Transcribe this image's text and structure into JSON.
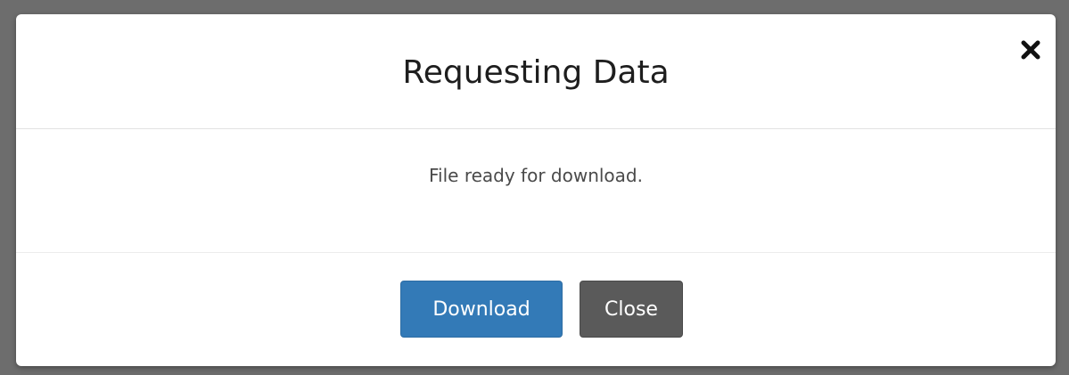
{
  "dialog": {
    "title": "Requesting Data",
    "close_icon": "close-x-icon",
    "message": "File ready for download.",
    "buttons": {
      "download_label": "Download",
      "close_label": "Close"
    },
    "colors": {
      "primary": "#337ab7",
      "secondary": "#5a5a5a",
      "backdrop": "#6d6d6d"
    }
  }
}
